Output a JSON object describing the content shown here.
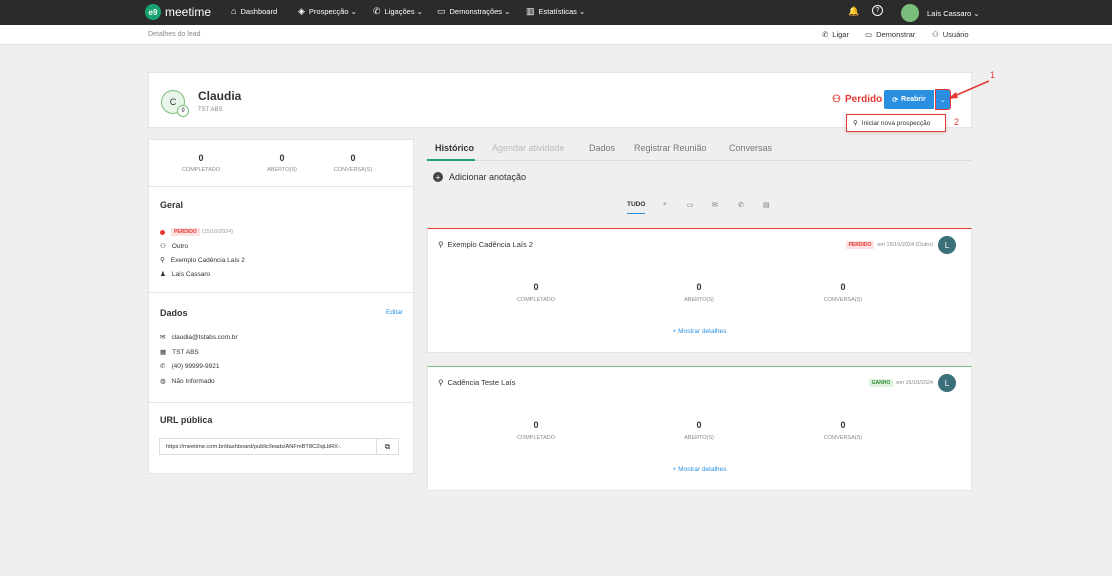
{
  "nav": {
    "logo_badge": "e9",
    "logo_text": "meetime",
    "items": [
      {
        "label": "Dashboard",
        "icon": "⌂"
      },
      {
        "label": "Prospecção ⌄",
        "icon": "◈"
      },
      {
        "label": "Ligações ⌄",
        "icon": "✆"
      },
      {
        "label": "Demonstrações ⌄",
        "icon": "▭"
      },
      {
        "label": "Estatísticas ⌄",
        "icon": "▥"
      }
    ],
    "user": "Laís Cassaro ⌄",
    "bell_icon": "🔔",
    "help_icon": "?"
  },
  "subbar": {
    "breadcrumb": "Detalhes do lead",
    "actions": [
      {
        "label": "Ligar",
        "icon": "✆"
      },
      {
        "label": "Demonstrar",
        "icon": "▭"
      },
      {
        "label": "Usuário",
        "icon": "⚇"
      }
    ]
  },
  "lead": {
    "initial": "C",
    "badge": "9",
    "name": "Claudia",
    "company": "TST ABS",
    "status_label": "Perdido",
    "reopen_label": "Reabrir",
    "menu_item": "Iniciar nova prospecção"
  },
  "annotations": {
    "one": "1",
    "two": "2"
  },
  "summary": {
    "stats": [
      {
        "value": "0",
        "label": "COMPLETADO"
      },
      {
        "value": "0",
        "label": "ABERTO(S)"
      },
      {
        "value": "0",
        "label": "CONVERSA(S)"
      }
    ]
  },
  "geral": {
    "title": "Geral",
    "status_tag": "PERDIDO",
    "status_date": "(15/10/2024)",
    "origin": "Outro",
    "cadence": "Exemplo Cadência Laís 2",
    "owner": "Laís Cassaro"
  },
  "dados": {
    "title": "Dados",
    "edit": "Editar",
    "email": "claudia@tstabs.com.br",
    "company": "TST ABS",
    "phone": "(40) 99999-9921",
    "website": "Não Informado"
  },
  "url": {
    "title": "URL pública",
    "value": "https://meetime.com.br/dashboard/public/leads/ANFmBT8C2iqLbRX-."
  },
  "tabs": [
    "Histórico",
    "Agendar atividade",
    "Dados",
    "Registrar Reunião",
    "Conversas"
  ],
  "add_note": "Adicionar anotação",
  "filters": {
    "all": "TUDO"
  },
  "cards": [
    {
      "title": "Exemplo Cadência Laís 2",
      "status": "PERDIDO",
      "date": "em 15/10/2024 (Outro)",
      "avatar": "L",
      "stats": [
        {
          "value": "0",
          "label": "COMPLETADO"
        },
        {
          "value": "0",
          "label": "ABERTO(S)"
        },
        {
          "value": "0",
          "label": "CONVERSA(S)"
        }
      ],
      "more": "+ Mostrar detalhes"
    },
    {
      "title": "Cadência Teste Laís",
      "status": "GANHO",
      "date": "em 15/10/2024",
      "avatar": "L",
      "stats": [
        {
          "value": "0",
          "label": "COMPLETADO"
        },
        {
          "value": "0",
          "label": "ABERTO(S)"
        },
        {
          "value": "0",
          "label": "CONVERSA(S)"
        }
      ],
      "more": "+ Mostrar detalhes"
    }
  ],
  "colors": {
    "accent": "#2a8fe0",
    "danger": "#e53935",
    "success": "#1aa36f",
    "nav_bg": "#2b2b2b"
  }
}
